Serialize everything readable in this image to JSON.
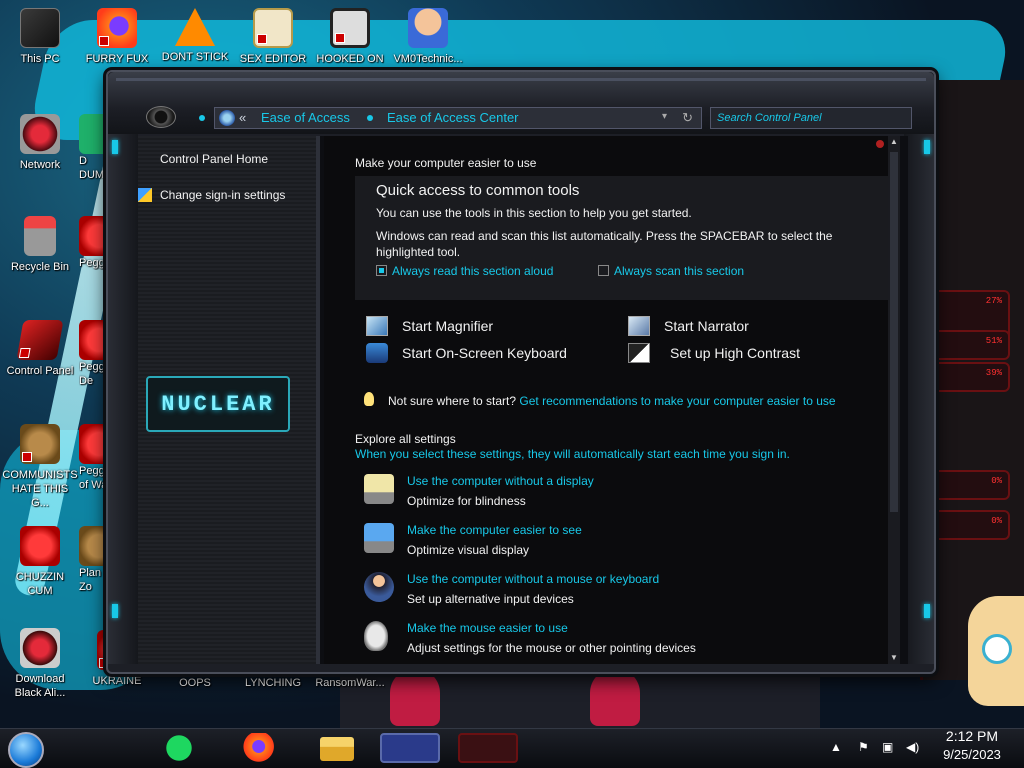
{
  "desktop": {
    "icons": [
      {
        "label": "This PC"
      },
      {
        "label": "FURRY FUX"
      },
      {
        "label": "DONT STICK"
      },
      {
        "label": "SEX EDITOR"
      },
      {
        "label": "HOOKED ON"
      },
      {
        "label": "VM0Technic..."
      },
      {
        "label": "Network"
      },
      {
        "label": "Recycle Bin"
      },
      {
        "label": "Control Panel"
      },
      {
        "label": "COMMUNISTS HATE THIS G..."
      },
      {
        "label": "CHUZZIN CUM"
      },
      {
        "label": "Download Black Ali..."
      },
      {
        "label": "UKRAINE"
      },
      {
        "label": "OOPS"
      },
      {
        "label": "LYNCHING"
      },
      {
        "label": "RansomWar..."
      },
      {
        "label": "Peggle"
      },
      {
        "label": "Peggle De"
      },
      {
        "label": "Peggle of Wa"
      },
      {
        "label": "Plan Zo"
      },
      {
        "label": "D DUM"
      }
    ],
    "wallpaper_readouts": [
      "27%",
      "51%",
      "39%",
      "0%",
      "0%"
    ]
  },
  "window": {
    "breadcrumb": [
      "Ease of Access",
      "Ease of Access Center"
    ],
    "back_chevrons": "«",
    "search_placeholder": "Search Control Panel",
    "left_nav": {
      "home": "Control Panel Home",
      "signin": "Change sign-in settings",
      "logo_text": "NUCLEAR"
    },
    "content": {
      "heading": "Make your computer easier to use",
      "quick_access": {
        "title": "Quick access to common tools",
        "desc": "You can use the tools in this section to help you get started.",
        "desc2": "Windows can read and scan this list automatically.  Press the SPACEBAR to select the highlighted tool.",
        "checkbox_read": {
          "label": "Always read this section aloud",
          "checked": true
        },
        "checkbox_scan": {
          "label": "Always scan this section",
          "checked": false
        }
      },
      "tools": [
        {
          "label": "Start Magnifier",
          "icon": "magnifier-icon"
        },
        {
          "label": "Start Narrator",
          "icon": "narrator-icon"
        },
        {
          "label": "Start On-Screen Keyboard",
          "icon": "keyboard-icon"
        },
        {
          "label": "Set up High Contrast",
          "icon": "high-contrast-icon"
        }
      ],
      "tip": {
        "prefix": "Not sure where to start?",
        "link": "Get recommendations to make your computer easier to use"
      },
      "explore": {
        "title": "Explore all settings",
        "subtitle": "When you select these settings, they will automatically start each time you sign in."
      },
      "settings": [
        {
          "link": "Use the computer without a display",
          "desc": "Optimize for blindness"
        },
        {
          "link": "Make the computer easier to see",
          "desc": "Optimize visual display"
        },
        {
          "link": "Use the computer without a mouse or keyboard",
          "desc": "Set up alternative input devices"
        },
        {
          "link": "Make the mouse easier to use",
          "desc": "Adjust settings for the mouse or other pointing devices"
        }
      ]
    }
  },
  "taskbar": {
    "clock_time": "2:12 PM",
    "clock_date": "9/25/2023"
  },
  "colors": {
    "accent": "#18c8e8",
    "window_bg": "#0b0b0d",
    "panel_bg": "#1a1b1f"
  }
}
